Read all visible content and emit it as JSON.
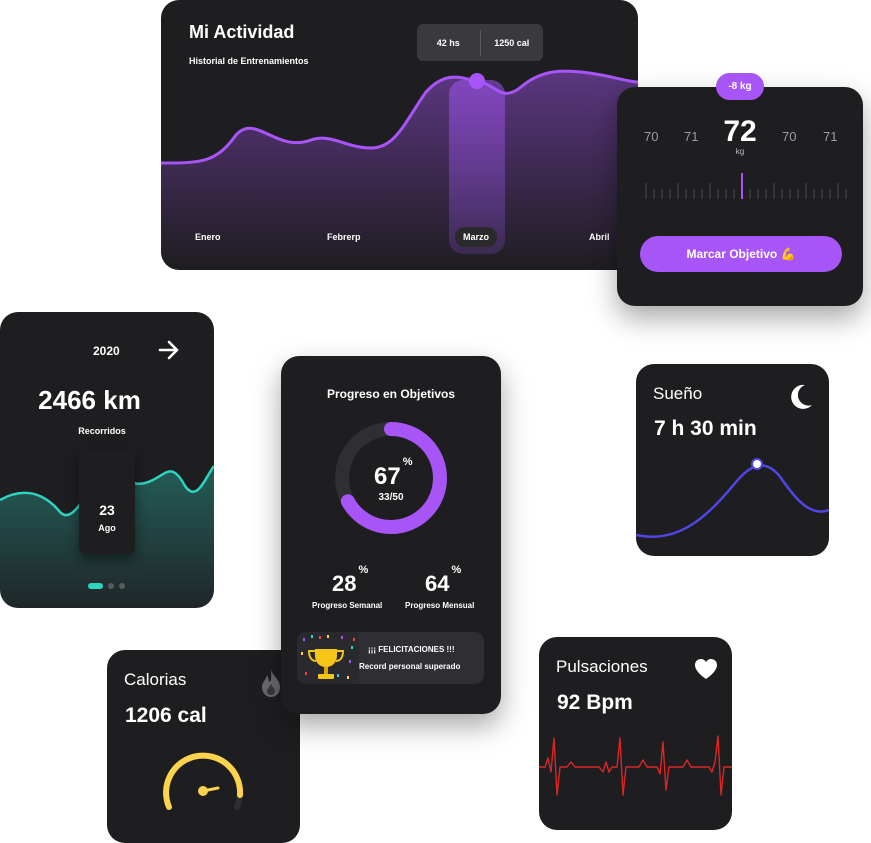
{
  "activity": {
    "title": "Mi Actividad",
    "subtitle": "Historial de Entrenamientos",
    "tooltip": {
      "hours": "42 hs",
      "calories": "1250 cal"
    },
    "months": [
      "Enero",
      "Febrerp",
      "Marzo",
      "Abril"
    ],
    "selected_month": "Marzo",
    "accent": "#a855f7"
  },
  "weight": {
    "badge": "-8 kg",
    "scale": [
      "70",
      "71",
      "72",
      "70",
      "71"
    ],
    "current": "72",
    "unit": "kg",
    "button": "Marcar Objetivo 💪"
  },
  "distance": {
    "year": "2020",
    "arrow_icon": "arrow-right-icon",
    "value": "2466 km",
    "label": "Recorridos",
    "day": "23",
    "month": "Ago",
    "accent": "#2dd4bf",
    "pages": 3,
    "active_page": 1
  },
  "progress": {
    "title": "Progreso en Objetivos",
    "percent": "67",
    "percent_sign": "%",
    "percent_fraction": 0.67,
    "fraction": "33/50",
    "weekly": "28",
    "weekly_label": "Progreso Semanal",
    "monthly": "64",
    "monthly_label": "Progreso Mensual",
    "achievement_title": "¡¡¡ FELICITACIONES !!!",
    "achievement_text": "Record personal superado"
  },
  "sleep": {
    "title": "Sueño",
    "value": "7 h 30 min",
    "icon": "moon-icon",
    "accent": "#4f46e5"
  },
  "calories": {
    "title": "Calorias",
    "value": "1206 cal",
    "icon": "flame-icon",
    "accent": "#fcd34d"
  },
  "pulse": {
    "title": "Pulsaciones",
    "value": "92 Bpm",
    "icon": "heart-icon",
    "accent": "#dc2626"
  }
}
